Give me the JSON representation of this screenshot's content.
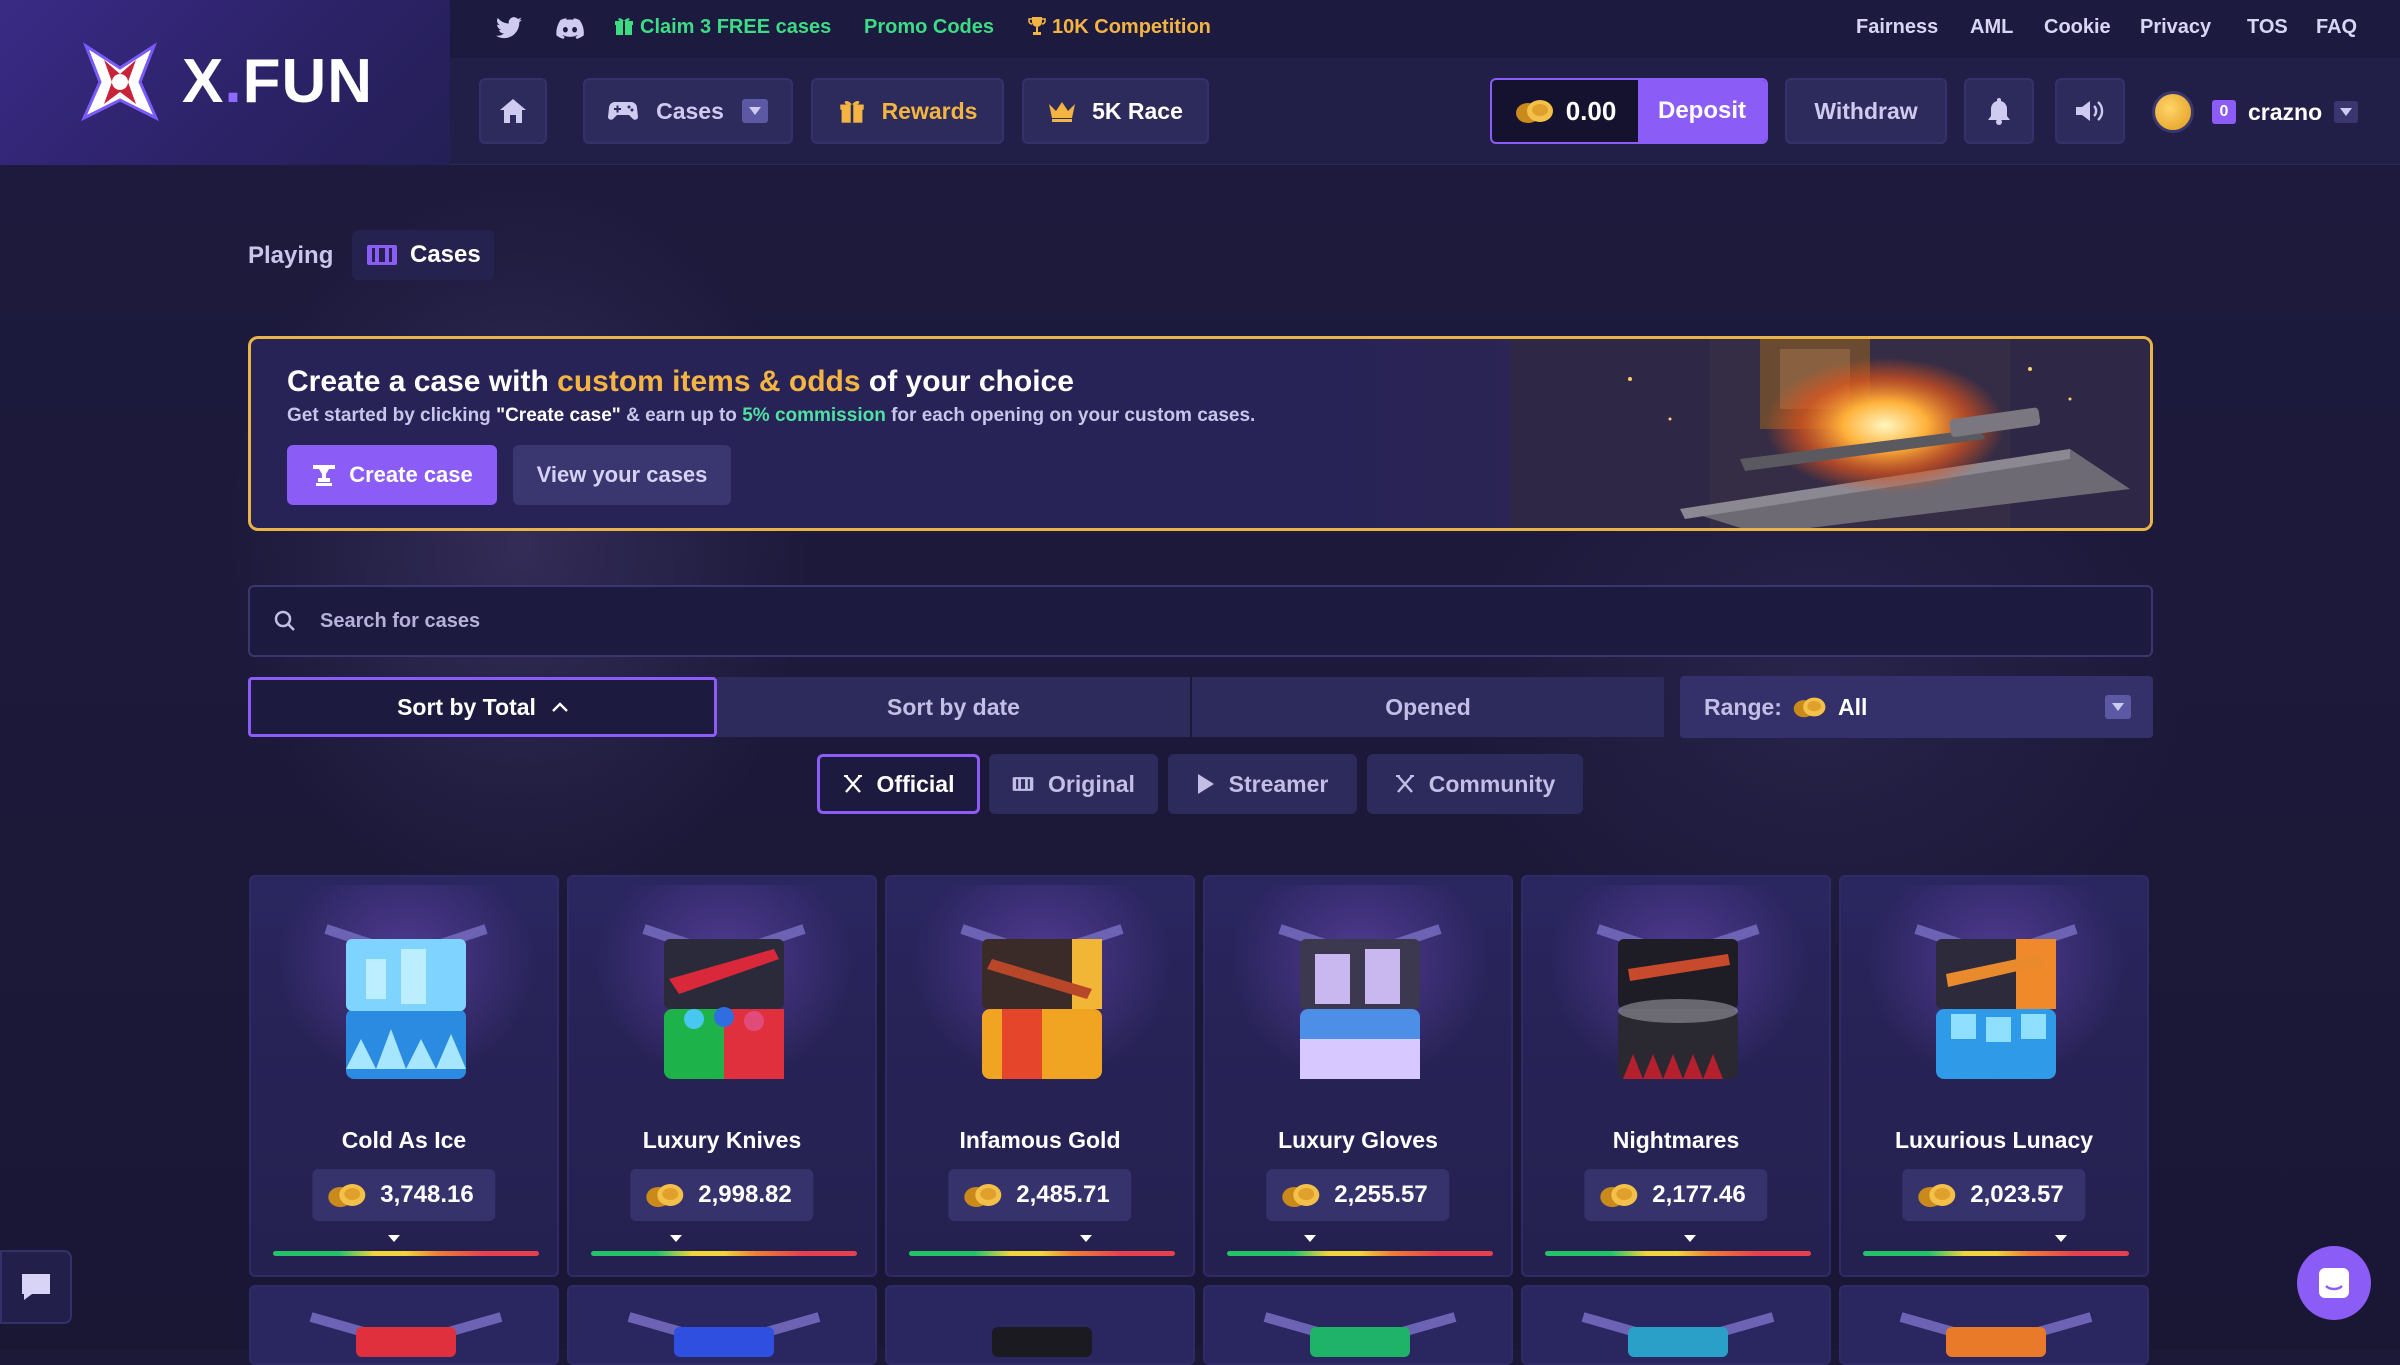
{
  "brand": {
    "name_part1": "X",
    "name_dot": ".",
    "name_part2": "FUN"
  },
  "promo_strip": {
    "claim": "Claim 3 FREE cases",
    "promo_codes": "Promo Codes",
    "competition": "10K Competition"
  },
  "legal_links": [
    "Fairness",
    "AML",
    "Cookie",
    "Privacy",
    "TOS",
    "FAQ"
  ],
  "nav": {
    "cases": "Cases",
    "rewards": "Rewards",
    "race": "5K Race",
    "balance": "0.00",
    "deposit": "Deposit",
    "withdraw": "Withdraw",
    "user_level": "0",
    "username": "crazno"
  },
  "breadcrumb": {
    "playing": "Playing",
    "current": "Cases"
  },
  "banner": {
    "title_prefix": "Create a case with ",
    "title_highlight": "custom items & odds",
    "title_suffix": " of your choice",
    "sub_prefix": "Get started by clicking ",
    "sub_bold": "\"Create case\"",
    "sub_mid": " & earn up to ",
    "sub_green": "5% commission",
    "sub_suffix": " for each opening on your custom cases.",
    "create_button": "Create case",
    "view_button": "View your cases"
  },
  "search": {
    "placeholder": "Search for cases",
    "value": ""
  },
  "sort": {
    "by_total": "Sort by Total",
    "by_date": "Sort by date",
    "opened": "Opened",
    "range_label": "Range:",
    "range_value": "All"
  },
  "categories": {
    "official": "Official",
    "original": "Original",
    "streamer": "Streamer",
    "community": "Community"
  },
  "cases": [
    {
      "name": "Cold As Ice",
      "price": "3,748.16"
    },
    {
      "name": "Luxury Knives",
      "price": "2,998.82"
    },
    {
      "name": "Infamous Gold",
      "price": "2,485.71"
    },
    {
      "name": "Luxury Gloves",
      "price": "2,255.57"
    },
    {
      "name": "Nightmares",
      "price": "2,177.46"
    },
    {
      "name": "Luxurious Lunacy",
      "price": "2,023.57"
    }
  ],
  "colors": {
    "accent": "#8b5cf6",
    "highlight": "#f3b443",
    "commission": "#4fe0a2",
    "promo_green": "#3ddc84",
    "competition_gold": "#f3b443"
  },
  "icons": [
    "twitter-icon",
    "discord-icon",
    "gift-icon",
    "trophy-icon",
    "home-icon",
    "gamepad-icon",
    "crown-icon",
    "coin-icon",
    "bell-icon",
    "volume-icon",
    "search-icon",
    "chevron-up-icon",
    "chat-icon",
    "messenger-icon"
  ]
}
